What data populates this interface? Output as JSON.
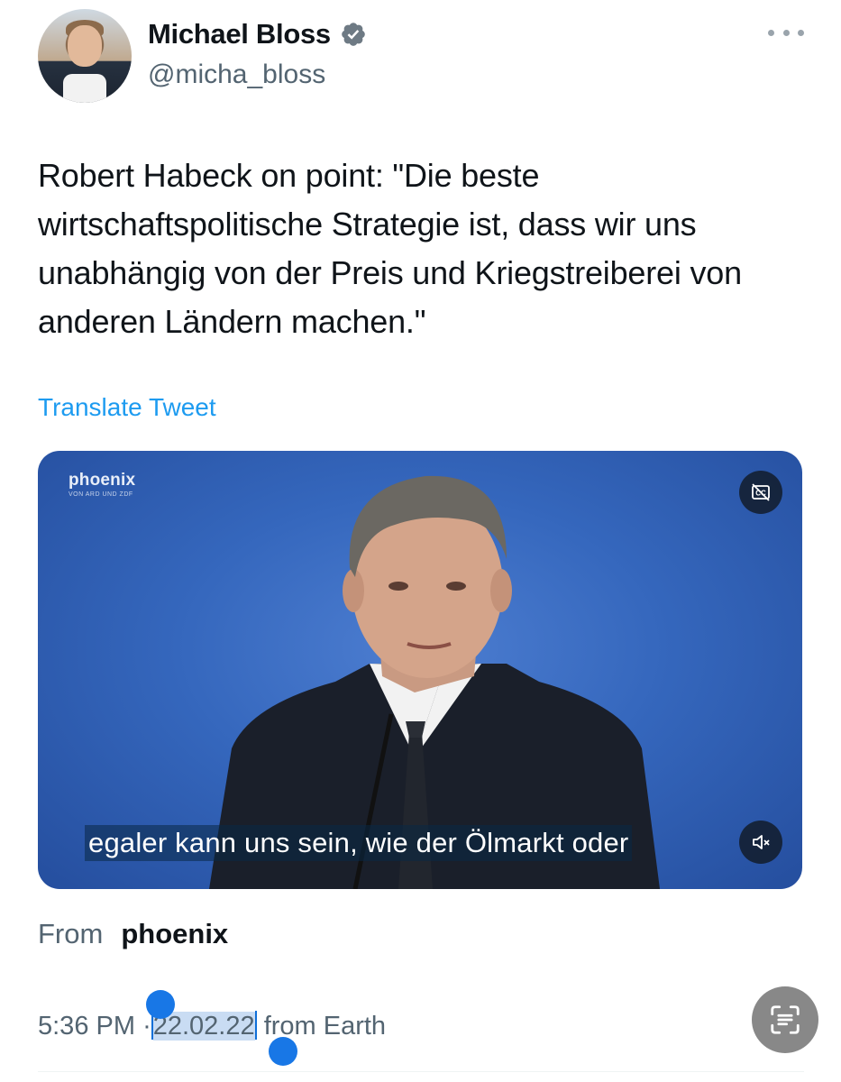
{
  "author": {
    "name": "Michael Bloss",
    "handle": "@micha_bloss",
    "verified": true,
    "avatar_icon": "profile-photo"
  },
  "tweet": {
    "text": "Robert Habeck on point: \"Die beste wirtschaftspolitische Strategie ist, dass wir uns unabhängig von der Preis und Kriegstreiberei von anderen Ländern machen.\"",
    "translate_label": "Translate Tweet"
  },
  "media": {
    "channel_logo": "phoenix",
    "channel_logo_sub": "VON ARD UND ZDF",
    "subtitle": "egaler kann uns sein, wie der Ölmarkt oder",
    "captions_icon": "closed-captions-off-icon",
    "mute_icon": "speaker-muted-icon"
  },
  "source": {
    "prefix": "From",
    "name": "phoenix"
  },
  "meta": {
    "time": "5:36 PM",
    "separator": "·",
    "date": "22.02.22",
    "suffix": "from Earth"
  },
  "colors": {
    "accent": "#1d9bf0",
    "selection": "#c9dcf3",
    "selection_handle": "#1877e6",
    "muted_text": "#536471"
  },
  "icons": {
    "more": "more-horizontal-icon",
    "verified": "verified-badge-icon",
    "live_text": "live-text-scan-icon"
  }
}
